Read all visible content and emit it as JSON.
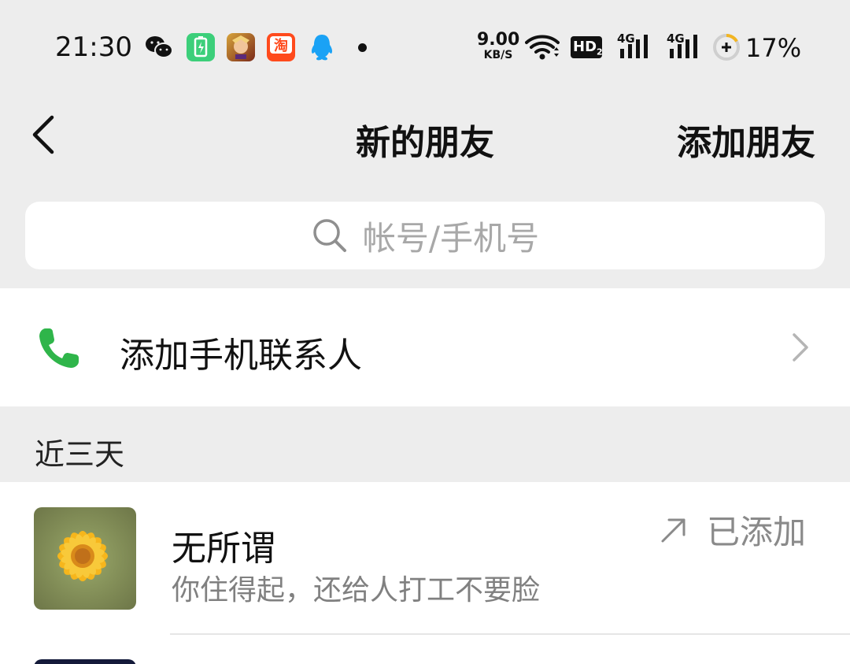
{
  "status_bar": {
    "time": "21:30",
    "net_speed_value": "9.00",
    "net_speed_unit": "KB/S",
    "hd_label": "HD",
    "hd_sub": "2",
    "signal_1_label": "4G",
    "signal_2_label": "4G",
    "battery_percent": "17%",
    "icons": [
      "wechat-icon",
      "battery-saver-app-icon",
      "game-app-icon",
      "taobao-app-icon",
      "qq-icon",
      "notification-dot",
      "wifi-icon",
      "hd-voice-icon",
      "signal-4g-icon",
      "signal-4g-icon",
      "battery-icon"
    ],
    "taobao_label": "淘"
  },
  "nav": {
    "title": "新的朋友",
    "action": "添加朋友",
    "back_icon": "back-icon"
  },
  "search": {
    "placeholder": "帐号/手机号",
    "icon": "search-icon"
  },
  "phone_contacts": {
    "label": "添加手机联系人",
    "icon": "phone-icon",
    "accent": "#2fb54a"
  },
  "section": {
    "label": "近三天"
  },
  "friends": [
    {
      "name": "无所谓",
      "message": "你住得起，还给人打工不要脸",
      "status": "已添加",
      "status_icon": "arrow-up-right-icon",
      "avatar": "sunflower-avatar"
    }
  ],
  "colors": {
    "background": "#ededed",
    "card": "#ffffff",
    "muted_text": "#808080",
    "wechat_green": "#07c160"
  }
}
